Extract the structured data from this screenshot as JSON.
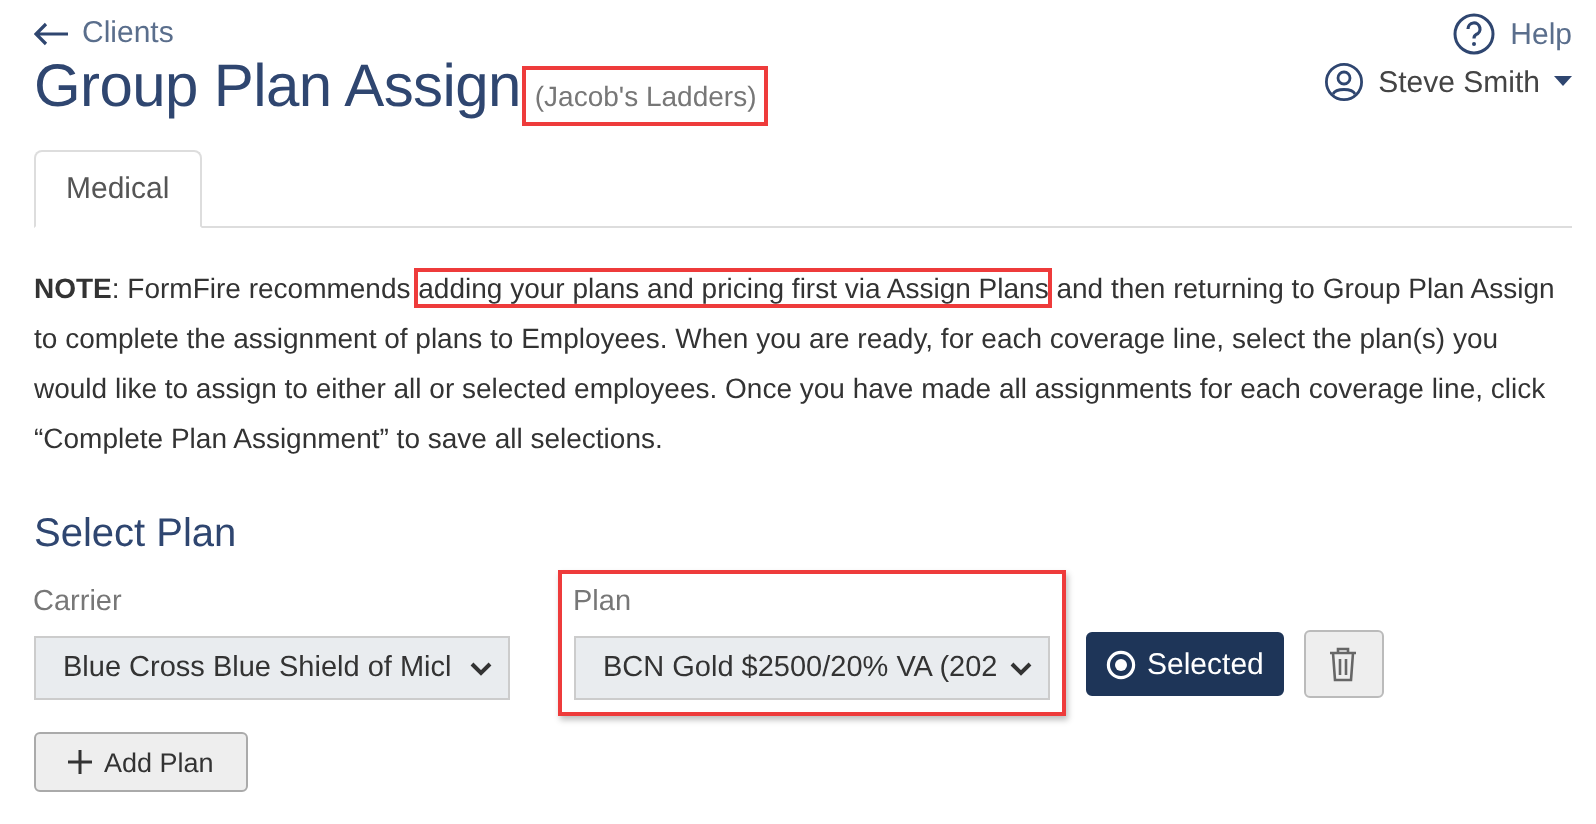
{
  "back_link": {
    "label": "Clients"
  },
  "header_links": {
    "help": "Help",
    "user": "Steve Smith"
  },
  "title": "Group Plan Assign",
  "subtitle": {
    "text": "(Jacob's Ladders)",
    "highlighted": true
  },
  "tabs": [
    {
      "label": "Medical",
      "selected": true
    }
  ],
  "note": [
    {
      "text": "**NOTE**: FormFire recommends ",
      "highlighted": false
    },
    {
      "text": "adding your plans and pricing first via Assign Plans",
      "highlighted": true
    },
    {
      "text": " and then returning to Group Plan Assign to complete the assignment of plans to Employees. When you are ready, for each coverage line, select the plan(s) you would like to assign to either all or selected employees. Once you have made all assignments for each coverage line, click “Complete Plan Assignment” to save all selections.",
      "highlighted": false
    }
  ],
  "section_title": "Select Plan",
  "fields": [
    {
      "label": "Carrier",
      "value": "Blue Cross Blue Shield of Micl",
      "highlighted": false
    },
    {
      "label": "Plan",
      "value": "BCN Gold $2500/20% VA (202",
      "highlighted": true
    }
  ],
  "status_button": {
    "label": "Selected",
    "selected": true
  },
  "add_button": {
    "label": "Add Plan"
  }
}
